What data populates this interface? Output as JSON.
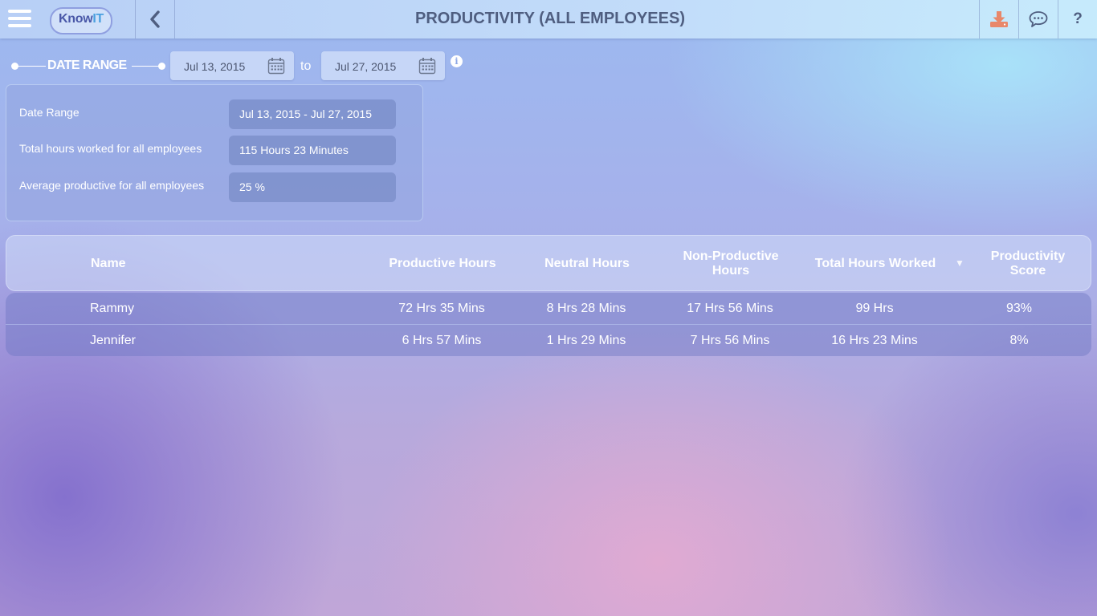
{
  "header": {
    "title": "PRODUCTIVITY (ALL EMPLOYEES)",
    "logo_text_a": "Know",
    "logo_text_b": "IT",
    "help_label": "?"
  },
  "icons": {
    "menu": "hamburger-icon",
    "back": "chevron-left-icon",
    "download": "download-icon",
    "chat": "chat-bubble-icon",
    "help": "question-icon",
    "calendar": "calendar-icon",
    "info": "info-icon",
    "sort": "sort-down-icon"
  },
  "colors": {
    "download_accent": "#e8876a",
    "header_text": "#4f5e80"
  },
  "date_range": {
    "label": "DATE RANGE",
    "from": "Jul 13, 2015",
    "to_label": "to",
    "to": "Jul 27, 2015",
    "info_glyph": "i"
  },
  "summary": {
    "rows": [
      {
        "label": "Date Range",
        "value": "Jul 13, 2015 - Jul 27, 2015"
      },
      {
        "label": "Total hours worked for all employees",
        "value": "115 Hours 23 Minutes"
      },
      {
        "label": "Average productive for all employees",
        "value": "25 %"
      }
    ]
  },
  "table": {
    "columns": [
      "Name",
      "Productive Hours",
      "Neutral Hours",
      "Non-Productive Hours",
      "Total Hours Worked",
      "Productivity Score"
    ],
    "sort_glyph": "▼",
    "rows": [
      [
        "Rammy",
        "72 Hrs 35 Mins",
        "8 Hrs 28 Mins",
        "17 Hrs 56 Mins",
        "99 Hrs",
        "93%"
      ],
      [
        "Jennifer",
        "6 Hrs 57 Mins",
        "1 Hrs 29 Mins",
        "7 Hrs 56 Mins",
        "16 Hrs 23 Mins",
        "8%"
      ]
    ]
  }
}
